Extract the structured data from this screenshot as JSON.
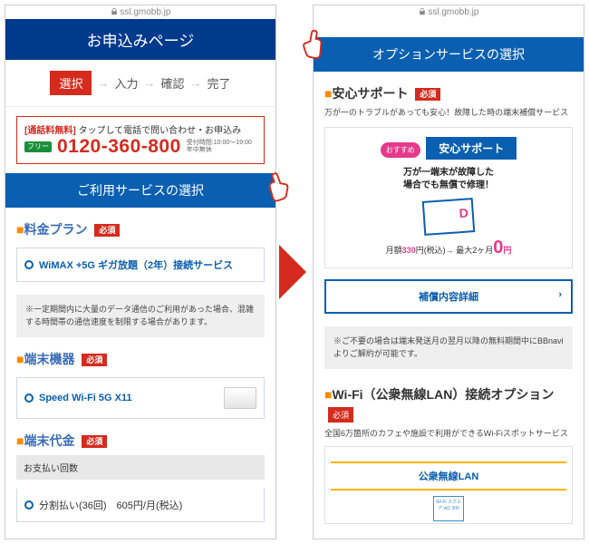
{
  "url": "ssl.gmobb.jp",
  "left": {
    "header": "お申込みページ",
    "steps": {
      "current": "選択",
      "s2": "入力",
      "s3": "確認",
      "s4": "完了"
    },
    "phone": {
      "free_label": "[通話料無料]",
      "tap_text": "タップして電話で問い合わせ・お申込み",
      "icon": "フリー",
      "number": "0120-360-800",
      "hours1": "受付時間:10:00〜19:00",
      "hours2": "年中無休"
    },
    "section_header": "ご利用サービスの選択",
    "plan": {
      "title": "料金プラン",
      "required": "必須",
      "option": "WiMAX +5G ギガ放題（2年）接続サービス",
      "note": "※一定期間内に大量のデータ通信のご利用があった場合、混雑する時間帯の通信速度を制限する場合があります。"
    },
    "device": {
      "title": "端末機器",
      "required": "必須",
      "option": "Speed Wi-Fi 5G X11"
    },
    "price": {
      "title": "端末代金",
      "required": "必須",
      "pay_header": "お支払い回数",
      "option": "分割払い(36回)　605円/月(税込)"
    }
  },
  "right": {
    "section_header": "オプションサービスの選択",
    "anshin": {
      "title": "安心サポート",
      "required": "必須",
      "sub": "万が一のトラブルがあっても安心！故障した時の端末補償サービス",
      "badge": "おすすめ",
      "promo_name": "安心サポート",
      "promo_msg1": "万が一端末が故障した",
      "promo_msg2": "場合でも無償で修理！",
      "price_pre": "月額",
      "price_val": "330",
      "price_unit": "円(税込)→",
      "price_max": "最大2ヶ月",
      "price_zero": "0",
      "price_yen": "円",
      "detail_btn": "補償内容詳細",
      "note": "※ご不要の場合は端末発送月の翌月以降の無料期間中にBBnaviよりご解約が可能です。"
    },
    "wifi": {
      "title": "Wi-Fi（公衆無線LAN）接続オプション",
      "required": "必須",
      "sub": "全国6万箇所のカフェや施設で利用ができるWi-Fiスポットサービス",
      "lan_header": "公衆無線LAN",
      "lan_img": "Wi-Fi スクエア wi2 300"
    }
  }
}
